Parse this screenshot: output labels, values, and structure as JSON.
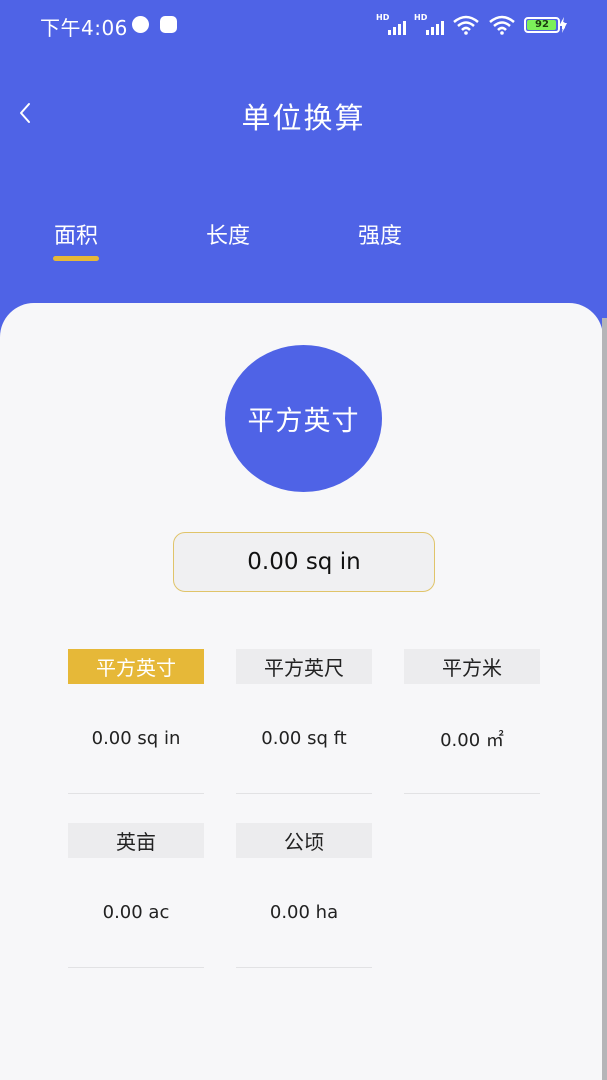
{
  "status_bar": {
    "time": "下午4:06",
    "signal_badge_1": "HD",
    "signal_badge_2": "HD",
    "battery": "92"
  },
  "header": {
    "title": "单位换算",
    "back_icon": "chevron-left-icon"
  },
  "tabs": [
    {
      "label": "面积",
      "active": true
    },
    {
      "label": "长度",
      "active": false
    },
    {
      "label": "强度",
      "active": false
    }
  ],
  "current_unit": "平方英寸",
  "input_value": "0.00 sq in",
  "units": [
    {
      "label": "平方英寸",
      "value": "0.00 sq in",
      "selected": true
    },
    {
      "label": "平方英尺",
      "value": "0.00 sq ft",
      "selected": false
    },
    {
      "label": "平方米",
      "value": "0.00 ㎡",
      "selected": false
    },
    {
      "label": "英亩",
      "value": "0.00 ac",
      "selected": false
    },
    {
      "label": "公顷",
      "value": "0.00 ha",
      "selected": false
    }
  ],
  "colors": {
    "primary": "#4f63e6",
    "accent": "#e6b838",
    "background": "#f7f7f9"
  }
}
